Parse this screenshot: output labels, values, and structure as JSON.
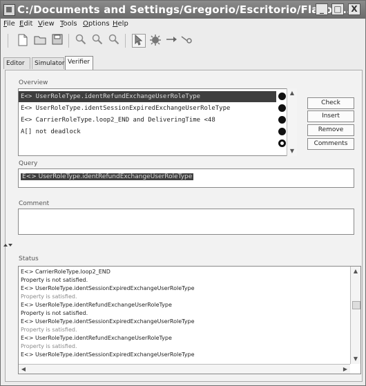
{
  "window": {
    "title": "C:/Documents and Settings/Gregorio/Escritorio/Flacos...",
    "minimize_symbol": "_",
    "maximize_symbol": "□",
    "close_symbol": "X"
  },
  "menubar": {
    "items": [
      {
        "mnemonic": "F",
        "rest": "ile"
      },
      {
        "mnemonic": "E",
        "rest": "dit"
      },
      {
        "mnemonic": "V",
        "rest": "iew"
      },
      {
        "mnemonic": "T",
        "rest": "ools"
      },
      {
        "mnemonic": "O",
        "rest": "ptions"
      },
      {
        "mnemonic": "H",
        "rest": "elp"
      }
    ]
  },
  "toolbar": {
    "icons": [
      "new-file-icon",
      "open-folder-icon",
      "save-icon",
      "zoom-in-icon",
      "zoom-out-icon",
      "zoom-fit-icon",
      "select-pointer-icon",
      "location-icon",
      "edge-icon",
      "nail-icon"
    ]
  },
  "tabs": [
    "Editor",
    "Simulator",
    "Verifier"
  ],
  "active_tab": "Verifier",
  "overview": {
    "label": "Overview",
    "rows": [
      {
        "text": "E<> UserRoleType.identRefundExchangeUserRoleType",
        "selected": true,
        "marker": "filled"
      },
      {
        "text": "E<> UserRoleType.identSessionExpiredExchangeUserRoleType",
        "selected": false,
        "marker": "filled"
      },
      {
        "text": "E<> CarrierRoleType.loop2_END and DeliveringTime <48",
        "selected": false,
        "marker": "filled"
      },
      {
        "text": "A[] not deadlock",
        "selected": false,
        "marker": "filled"
      },
      {
        "text": "",
        "selected": false,
        "marker": "hollow"
      }
    ]
  },
  "buttons": {
    "check": "Check",
    "insert": "Insert",
    "remove": "Remove",
    "comments": "Comments"
  },
  "query": {
    "label": "Query",
    "value": "E<> UserRoleType.identRefundExchangeUserRoleType"
  },
  "comment": {
    "label": "Comment",
    "value": ""
  },
  "status": {
    "label": "Status",
    "lines": [
      {
        "text": "E<> CarrierRoleType.loop2_END",
        "gray": false
      },
      {
        "text": "Property is not satisfied.",
        "gray": false
      },
      {
        "text": "E<> UserRoleType.identSessionExpiredExchangeUserRoleType",
        "gray": false
      },
      {
        "text": "Property is satisfied.",
        "gray": true
      },
      {
        "text": "E<> UserRoleType.identRefundExchangeUserRoleType",
        "gray": false
      },
      {
        "text": "Property is not satisfied.",
        "gray": false
      },
      {
        "text": "E<> UserRoleType.identSessionExpiredExchangeUserRoleType",
        "gray": false
      },
      {
        "text": "Property is satisfied.",
        "gray": true
      },
      {
        "text": "E<> UserRoleType.identRefundExchangeUserRoleType",
        "gray": false
      },
      {
        "text": "Property is satisfied.",
        "gray": true
      },
      {
        "text": "E<> UserRoleType.identSessionExpiredExchangeUserRoleType",
        "gray": false
      }
    ]
  },
  "colors": {
    "selection": "#3e3e3e",
    "titlebar": "#7a7a7a"
  }
}
